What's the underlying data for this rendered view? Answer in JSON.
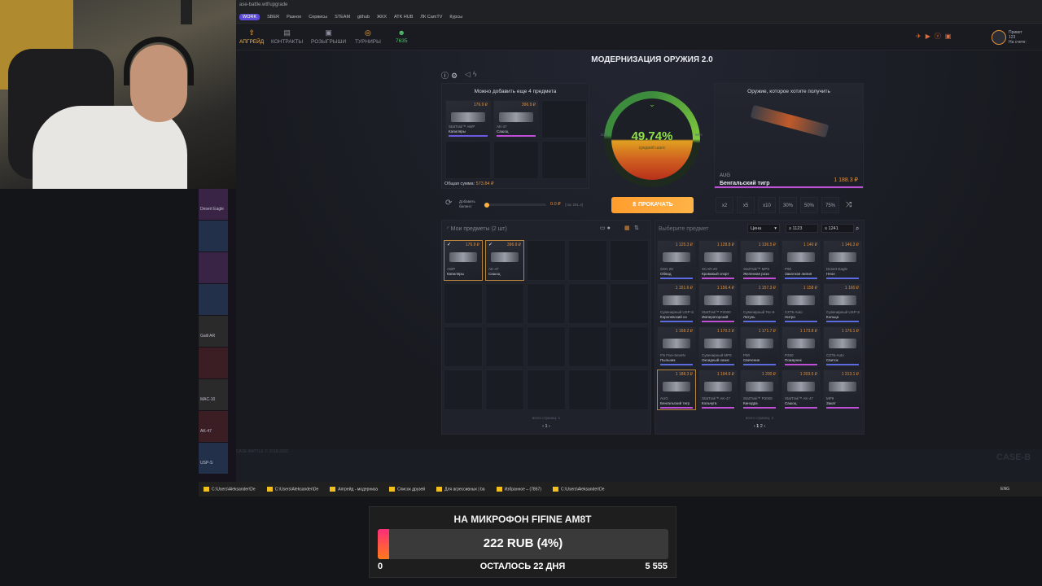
{
  "browser": {
    "url": "ase-battle.wtf/upgrade",
    "bookmarks": [
      "WORK",
      "SBER",
      "Разное",
      "Сервисы",
      "STEAM",
      "github",
      "ЖКХ",
      "ATK HUB",
      "ЛК CamTV",
      "Курсы"
    ]
  },
  "site_nav": {
    "items": [
      {
        "label": "АПГРЕЙД",
        "icon": "upgrade-icon"
      },
      {
        "label": "КОНТРАКТЫ",
        "icon": "contract-icon"
      },
      {
        "label": "РОЗЫГРЫШИ",
        "icon": "gift-icon"
      },
      {
        "label": "ТУРНИРЫ",
        "icon": "medal-icon"
      },
      {
        "label": "7635",
        "icon": "users-icon"
      }
    ],
    "profile_name": "Привет",
    "profile_balance": "123",
    "profile_label": "На счете:"
  },
  "upgrade": {
    "title": "МОДЕРНИЗАЦИЯ ОРУЖИЯ 2.0",
    "can_add_label": "Можно добавить еще",
    "can_add_count": "4 предмета",
    "selected_items": [
      {
        "price": "176.9 ₽",
        "type": "StatTrak™ AWP",
        "name": "Капиляры",
        "bar": "#6b5be0"
      },
      {
        "price": "396.9 ₽",
        "type": "AK-47",
        "name": "Сашоц",
        "bar": "#c04fd8"
      }
    ],
    "total_label": "Общая сумма:",
    "total_value": "573.84 ₽",
    "chance_percent": "49.74%",
    "chance_label": "средний шанс",
    "gauge_left_label": "50%",
    "gauge_right_label": "50%",
    "balance_label": "Добавить баланс:",
    "balance_value": "0.0 ₽",
    "balance_hint": "(тах 291.4)",
    "upgrade_button": "ПРОКАЧАТЬ",
    "target_label": "Оружие, которое хотите получить",
    "target_weapon_type": "AUG",
    "target_weapon_name": "Бенгальский тигр",
    "target_price": "1 188.3 ₽",
    "multipliers": [
      "x2",
      "x5",
      "x10",
      "30%",
      "50%",
      "75%"
    ]
  },
  "inventory": {
    "title": "Мои предметы (2 шт)",
    "items": [
      {
        "price": "176.9 ₽",
        "type": "AWP",
        "name": "Капиляры"
      },
      {
        "price": "396.9 ₽",
        "type": "AK-47",
        "name": "Сашоц"
      }
    ],
    "pages_label": "всего страниц: 1",
    "page": "1"
  },
  "market": {
    "title": "Выберите предмет",
    "sort": "Цена",
    "min_price": "1123",
    "max_price": "1241",
    "items": [
      {
        "price": "1 125.3 ₽",
        "type": "SSG 08",
        "name": "Обвод",
        "bar": "#5b6be0"
      },
      {
        "price": "1 128.8 ₽",
        "type": "SCAR-20",
        "name": "Кровавый спорт",
        "bar": "#c04fd8"
      },
      {
        "price": "1 136.5 ₽",
        "type": "StatTrak™ MP9",
        "name": "Железная роза",
        "bar": "#c04fd8"
      },
      {
        "price": "1 140 ₽",
        "type": "P90",
        "name": "Закатная лилия",
        "bar": "#5b6be0"
      },
      {
        "price": "1 146.3 ₽",
        "type": "Desert Eagle",
        "name": "Неон",
        "bar": "#5b6be0"
      },
      {
        "price": "1 151.6 ₽",
        "type": "Сувенирный USP-S",
        "name": "Королевский си",
        "bar": "#5b6be0"
      },
      {
        "price": "1 156.4 ₽",
        "type": "StatTrak™ P2000",
        "name": "Императорский",
        "bar": "#c04fd8"
      },
      {
        "price": "1 157.3 ₽",
        "type": "Сувенирный Tec-9",
        "name": "Латунь",
        "bar": "#5b6be0"
      },
      {
        "price": "1 158 ₽",
        "type": "CZ75-Auto",
        "name": "Нитро",
        "bar": "#5b6be0"
      },
      {
        "price": "1 160 ₽",
        "type": "Сувенирный USP-S",
        "name": "Кольца",
        "bar": "#5b6be0"
      },
      {
        "price": "1 168.2 ₽",
        "type": "FN Five-SeveN",
        "name": "Пыльник",
        "bar": "#5b6be0"
      },
      {
        "price": "1 170.2 ₽",
        "type": "Сувенирный MP5",
        "name": "Оксидный оазис",
        "bar": "#5b6be0"
      },
      {
        "price": "1 171.7 ₽",
        "type": "P90",
        "name": "Свечение",
        "bar": "#5b6be0"
      },
      {
        "price": "1 173.8 ₽",
        "type": "P250",
        "name": "Пожарник",
        "bar": "#c04fd8"
      },
      {
        "price": "1 176.1 ₽",
        "type": "CZ75-Auto",
        "name": "Свиток",
        "bar": "#5b6be0"
      },
      {
        "price": "1 188.3 ₽",
        "type": "AUG",
        "name": "Бенгальский тигр",
        "bar": "#c04fd8"
      },
      {
        "price": "1 194.6 ₽",
        "type": "StatTrak™ AK-47",
        "name": "Кольчуга",
        "bar": "#c04fd8"
      },
      {
        "price": "1 200 ₽",
        "type": "StatTrak™ P2000",
        "name": "Кинодра",
        "bar": "#c04fd8"
      },
      {
        "price": "1 203.5 ₽",
        "type": "StatTrak™ AK-47",
        "name": "Сашоц",
        "bar": "#c04fd8"
      },
      {
        "price": "1 213.1 ₽",
        "type": "MP9",
        "name": "Закат",
        "bar": "#c04fd8"
      }
    ],
    "pages_label": "всего страниц: 2",
    "pages": [
      "1",
      "2"
    ]
  },
  "footer": {
    "copyright": "CASE-BATTLE © 2018-2020"
  },
  "left_strip": {
    "items": [
      "Desert Eagle",
      "",
      "",
      "",
      "Galil AR",
      "",
      "MAC-10",
      "AK-47",
      "USP-S"
    ]
  },
  "taskbar": {
    "items": [
      "C:\\Users\\Aleksander\\De",
      "C:\\Users\\Aleksander\\De",
      "Апгрейд - модерниза",
      "Список друзей",
      "Для агрессивных | ba",
      "Избранное – (7867)",
      "C:\\Users\\Aleksander\\De"
    ],
    "lang": "ENG"
  },
  "donation_goal": {
    "title": "НА МИКРОФОН FIFINE AM8T",
    "amount": "222 RUB (4%)",
    "progress": 0.04,
    "min": "0",
    "remaining": "ОСТАЛОСЬ 22 ДНЯ",
    "max": "5 555"
  },
  "colors": {
    "accent": "#ffb23f",
    "chance": "#8fe04a",
    "goal_fill": "#ff2d7a"
  }
}
